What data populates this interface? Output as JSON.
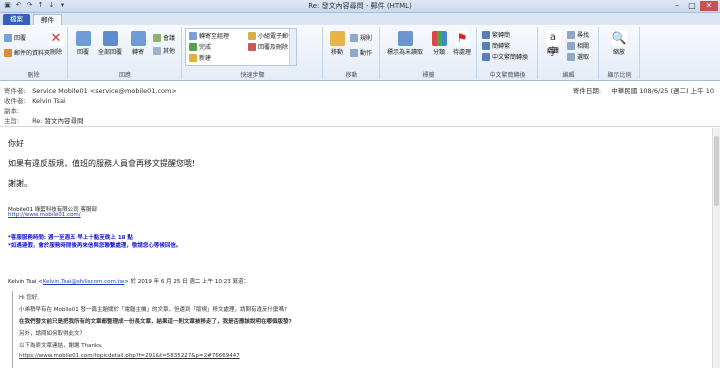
{
  "window": {
    "title": "Re: 發文內容尋問 - 郵件 (HTML)"
  },
  "tabs": {
    "file": "檔案",
    "home": "郵件"
  },
  "ribbon": {
    "reply": "回覆",
    "forward_folder": "郵件的資料夾",
    "delete": "刪除",
    "reply_all": "全部回覆",
    "forward": "轉寄",
    "meeting": "會議",
    "more": "其他",
    "qs_items": [
      "轉寄至經理",
      "小組電子郵件",
      "完成",
      "回覆及刪除",
      "新建"
    ],
    "move": "移動",
    "rules": "規則",
    "actions": "動作",
    "mark_unread": "標示為未讀取",
    "categorize": "分類",
    "followup": "待處理",
    "trad_to_simp": "繁轉簡",
    "simp_to_trad": "簡轉繁",
    "convert": "中文繁簡轉換",
    "translate": "翻譯",
    "find": "尋找",
    "related": "相關",
    "select": "選取",
    "zoom": "縮放",
    "group_labels": [
      "刪除",
      "回應",
      "快速步驟",
      "移動",
      "標籤",
      "中文繁簡轉換",
      "編輯",
      "顯示比例"
    ]
  },
  "header": {
    "from_label": "寄件者:",
    "from": "Service Mobile01 <service@mobile01.com>",
    "to_label": "收件者:",
    "to": "Kelvin Tsai",
    "cc_label": "副本:",
    "cc": "",
    "subject_label": "主旨:",
    "subject": "Re: 發文內容尋問",
    "sent_label": "寄件日期:",
    "sent": "中華民國 108/6/25 (週二) 上午 10"
  },
  "body": {
    "greeting": "你好",
    "line1": "如果有違反版規，值班的服務人員會再移文提醒您哦!",
    "thanks": "謝謝。",
    "company": "Mobile01 綠藍科技有限公司 客服部",
    "company_link": "http://www.mobile01.com/",
    "service_hours": "*客服服務時間: 週一至週五 早上十點至晚上 18 點",
    "service_note": "*如遇連假，會於服務時間後再來信與您聯繫處理，敬請您心等候回信。",
    "quote_header_name": "Kelvin Tsai <",
    "quote_header_email": "Kelvin.Tsai@shiliscom.com.tw",
    "quote_header_rest": "> 於 2019 年 6 月 25 日 週二 上午 10:23 寫道：",
    "q_greeting": "Hi 您好,",
    "q_line1": "小弟稍早有在 Mobile01 發一篇主題關於「電腦主機」的文章，但遭到「版規」移文處理，請問有違反什麼嗎?",
    "q_line2": "在我們發文前只是把我所有的文章都整理成一份長文章，結果這一則文章被移走了，我是否應該說明在哪個版發?",
    "q_line3": "另外，請問如何取得此文？",
    "q_line4": "以下為原文章連結，謝謝 Thanks.",
    "q_link": "https://www.mobile01.com/topicdetail.php?f=291&t=5835227&p=2#76669447"
  }
}
